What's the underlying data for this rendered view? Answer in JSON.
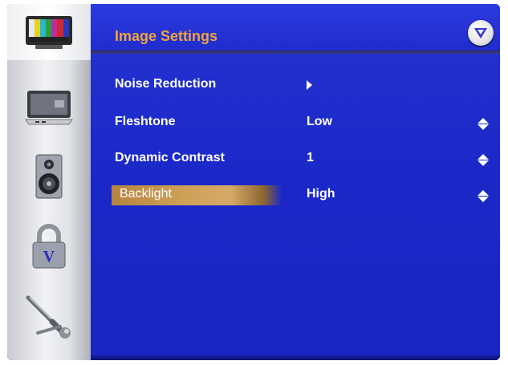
{
  "header": {
    "title": "Image Settings",
    "logo_icon": "v-logo-icon"
  },
  "sidebar": {
    "items": [
      {
        "icon": "tv-picture-icon",
        "selected": true
      },
      {
        "icon": "monitor-input-icon",
        "selected": false
      },
      {
        "icon": "speaker-audio-icon",
        "selected": false
      },
      {
        "icon": "lock-icon",
        "selected": false
      },
      {
        "icon": "wrench-setup-icon",
        "selected": false
      }
    ]
  },
  "menu": {
    "items": [
      {
        "label": "Noise Reduction",
        "value": "",
        "control": "submenu-arrow"
      },
      {
        "label": "Fleshtone",
        "value": "Low",
        "control": "up-down"
      },
      {
        "label": "Dynamic Contrast",
        "value": "1",
        "control": "up-down"
      },
      {
        "label": "Backlight",
        "value": "High",
        "control": "up-down",
        "highlighted": true
      }
    ]
  },
  "colors": {
    "panel_blue": "#1c28c4",
    "title_orange": "#f2a33a",
    "highlight_gold": "#cfa25a"
  }
}
